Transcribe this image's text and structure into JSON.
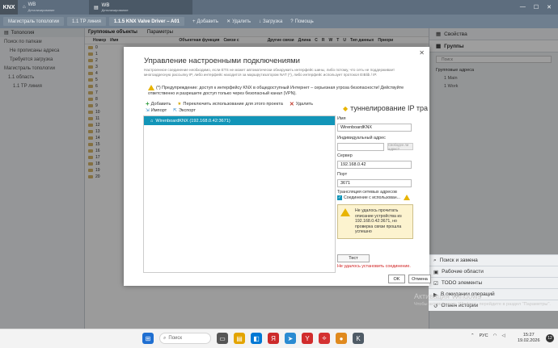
{
  "topbar": {
    "logo": "KNX",
    "home_tab": {
      "title": "WB",
      "subtitle": "Детализирование"
    },
    "active_tab": {
      "title": "WB",
      "subtitle": "Детализирование"
    },
    "controls": [
      "—",
      "☐",
      "✕"
    ]
  },
  "ribbon": {
    "crumb1": "Магистраль топологии",
    "crumb2": "1.1 TP линия",
    "crumb3": "1.1.5 KNX Valve Driver – A01",
    "add": "Добавить",
    "delete": "Удалить",
    "load": "Загрузка",
    "help": "Помощь"
  },
  "left": {
    "header": "Топология",
    "items": [
      "Поиск по папкам",
      "Не прописаны адреса",
      "Требуется загрузка",
      "Магистраль топологии",
      "1.1 область",
      "1.1 TP линия"
    ]
  },
  "mid": {
    "tabs": [
      "Групповые объекты",
      "Параметры"
    ],
    "columns": [
      "Номер",
      "Имя",
      "Объектная функция",
      "Связи с",
      "Другие связи",
      "Длина",
      "С",
      "R",
      "W",
      "T",
      "U",
      "Тип данных",
      "Приори"
    ],
    "rows": [
      "0",
      "1",
      "2",
      "3",
      "4",
      "5",
      "6",
      "7",
      "8",
      "9",
      "10",
      "11",
      "12",
      "13",
      "14",
      "15",
      "16",
      "17",
      "18",
      "19",
      "20"
    ]
  },
  "right": {
    "properties": "Свойства",
    "groups": "Группы",
    "search_placeholder": "Поиск",
    "tree_root": "Групповые адреса",
    "tree_items": [
      "1 Main",
      "1 Work"
    ]
  },
  "dialog": {
    "close": "✕",
    "title": "Управление настроенными подключениями",
    "description": "Настроенное соединение необходимо, если ETS не может автоматически обнаружить интерфейс шины, либо потому, что сеть не поддерживает многоадресную рассылку IP, либо интерфейс находится за маршрутизатором NAT (*), либо интерфейс использует протокол EIBlib / IP.",
    "warning": "(*) Предупреждение: доступ к интерфейсу KNX в общедоступный Интернет – серьезная угроза безопасности! Действуйте ответственно и разрешите доступ только через безопасный канал (VPN).",
    "toolbar": {
      "add": "Добавить",
      "toggle": "Переключить использование для этого проекта",
      "delete": "Удалить",
      "import": "Импорт",
      "export": "Экспорт"
    },
    "list_item": "WirenboardKNX (192.168.0.42:3671)",
    "props_title": "туннелирование IP тра",
    "name_label": "Имя",
    "name_value": "WirenboardKNX",
    "individual_label": "Индивидуальный адрес",
    "individual_value": "",
    "free_address_btn": "Свободен ли адрес?",
    "server_label": "Сервер",
    "server_value": "192.168.0.42",
    "port_label": "Порт",
    "port_value": "3671",
    "translation_label": "Трансляция сетевых адресов",
    "tunnel_option": "Соединение с использован...",
    "message": "Не удалось прочитать описание устройства из 192.168.0.42:3671, но проверка связи прошла успешно",
    "test_btn": "Тест",
    "error": "Не удалось установить соединение.",
    "ok": "OK",
    "cancel": "Отмена"
  },
  "watermark": {
    "line1": "Активация Windows",
    "line2": "Чтобы активировать Windows, перейдите в раздел \"Параметры\"."
  },
  "bottom_panels": [
    "Поиск и замена",
    "Рабочие области",
    "TODO элементы",
    "В ожидании операций",
    "Отмен истории"
  ],
  "taskbar": {
    "search": "Поиск",
    "lang": "РУС",
    "time": "15:27",
    "date": "19.02.2026",
    "notifications": "12"
  }
}
